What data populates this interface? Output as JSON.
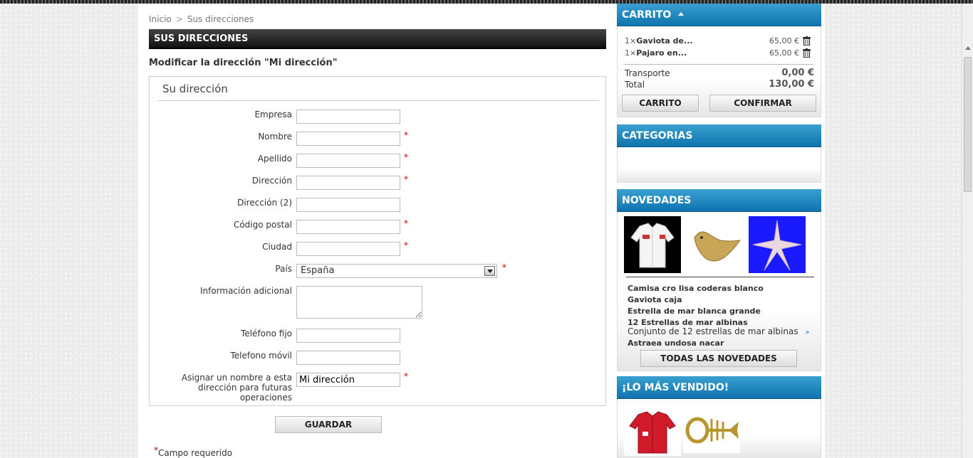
{
  "breadcrumb": {
    "home": "Inicio",
    "sep": ">",
    "current": "Sus direcciones"
  },
  "section_title": "SUS DIRECCIONES",
  "form_heading": "Modificar la dirección \"Mi dirección\"",
  "legend": "Su dirección",
  "fields": {
    "company": {
      "label": "Empresa",
      "value": ""
    },
    "first_name": {
      "label": "Nombre",
      "value": ""
    },
    "last_name": {
      "label": "Apellido",
      "value": ""
    },
    "address1": {
      "label": "Dirección",
      "value": ""
    },
    "address2": {
      "label": "Dirección (2)",
      "value": ""
    },
    "postcode": {
      "label": "Código postal",
      "value": ""
    },
    "city": {
      "label": "Ciudad",
      "value": ""
    },
    "country": {
      "label": "País",
      "value": "España"
    },
    "other": {
      "label": "Información adicional",
      "value": ""
    },
    "phone": {
      "label": "Teléfono fijo",
      "value": ""
    },
    "mobile": {
      "label": "Telefono móvil",
      "value": ""
    },
    "alias": {
      "label": "Asignar un nombre a esta dirección para futuras operaciones",
      "value": "Mi dirección"
    }
  },
  "required_mark": "*",
  "save_label": "GUARDAR",
  "required_note": "Campo requerido",
  "cart": {
    "title": "CARRITO",
    "items": [
      {
        "qty": "1×",
        "name": "Gaviota de...",
        "price": "65,00 €"
      },
      {
        "qty": "1×",
        "name": "Pajaro en...",
        "price": "65,00 €"
      }
    ],
    "shipping_label": "Transporte",
    "shipping_value": "0,00 €",
    "total_label": "Total",
    "total_value": "130,00 €",
    "cart_button": "CARRITO",
    "confirm_button": "CONFIRMAR"
  },
  "categories": {
    "title": "CATEGORIAS"
  },
  "new_products": {
    "title": "NOVEDADES",
    "items": [
      "Camisa cro lisa coderas blanco",
      "Gaviota caja",
      "Estrella de mar blanca grande",
      "12 Estrellas de mar albinas"
    ],
    "description": "Conjunto de 12 estrellas de mar albinas",
    "last_item": "Astraea undosa nacar",
    "all_button": "TODAS LAS NOVEDADES"
  },
  "best_sellers": {
    "title": "¡LO MÁS VENDIDO!"
  },
  "colors": {
    "accent": "#1b82bd",
    "dark_bar": "#1a1a1a",
    "required": "#cc0000"
  }
}
